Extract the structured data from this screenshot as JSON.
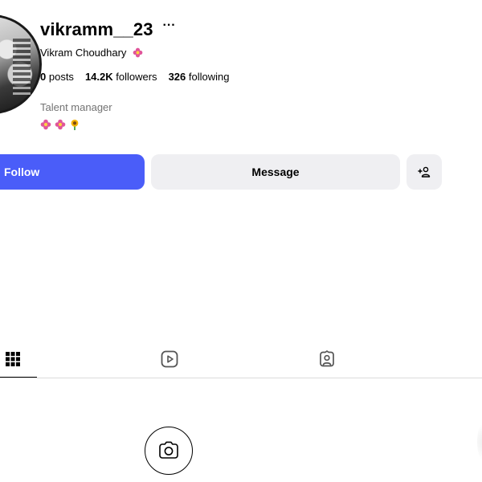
{
  "profile": {
    "username": "vikramm__23",
    "more_label": "···",
    "full_name": "Vikram Choudhary",
    "bio_title": "Talent manager",
    "bio_emoji_icons": [
      "flower-icon",
      "flower-icon",
      "sunflower-icon"
    ]
  },
  "stats": {
    "posts_count": "0",
    "posts_label": "posts",
    "followers_count": "14.2K",
    "followers_label": "followers",
    "following_count": "326",
    "following_label": "following"
  },
  "actions": {
    "follow_label": "Follow",
    "message_label": "Message",
    "add_icon": "add-person-icon"
  },
  "tabs": [
    {
      "icon": "grid-icon",
      "active": true
    },
    {
      "icon": "reels-icon",
      "active": false
    },
    {
      "icon": "tagged-icon",
      "active": false
    }
  ],
  "empty_state": {
    "icon": "camera-icon"
  },
  "colors": {
    "accent": "#4a5df9",
    "secondary_button": "#efeff2",
    "muted_text": "#737373",
    "divider": "#dbdbdb"
  }
}
